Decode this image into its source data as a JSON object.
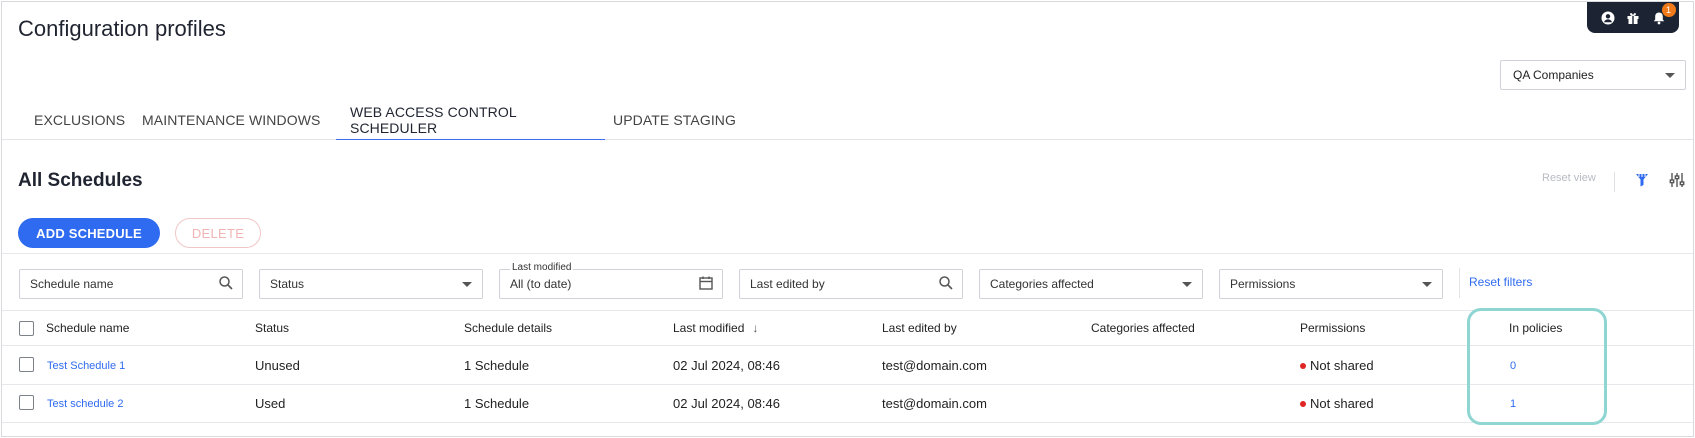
{
  "page": {
    "title": "Configuration profiles"
  },
  "topbar": {
    "icons": [
      "user-icon",
      "gift-icon",
      "bell-icon"
    ],
    "notification_count": "1"
  },
  "company_select": {
    "value": "QA Companies"
  },
  "tabs": [
    {
      "label": "EXCLUSIONS",
      "active": false
    },
    {
      "label": "MAINTENANCE WINDOWS",
      "active": false
    },
    {
      "label": "WEB ACCESS CONTROL SCHEDULER",
      "active": true
    },
    {
      "label": "UPDATE STAGING",
      "active": false
    }
  ],
  "section": {
    "title": "All Schedules",
    "reset_view": "Reset view"
  },
  "actions": {
    "add": "ADD SCHEDULE",
    "delete": "DELETE"
  },
  "filters": {
    "schedule_name": "Schedule name",
    "status": "Status",
    "last_modified_label": "Last modified",
    "last_modified_value": "All (to date)",
    "last_edited_by": "Last edited by",
    "categories": "Categories affected",
    "permissions": "Permissions",
    "reset": "Reset filters"
  },
  "table": {
    "columns": [
      "Schedule name",
      "Status",
      "Schedule details",
      "Last modified",
      "Last edited by",
      "Categories affected",
      "Permissions",
      "In policies"
    ],
    "rows": [
      {
        "name": "Test Schedule 1",
        "status": "Unused",
        "details": "1 Schedule",
        "modified": "02 Jul 2024, 08:46",
        "edited_by": "test@domain.com",
        "categories": "",
        "permissions": "Not shared",
        "policies": "0"
      },
      {
        "name": "Test schedule 2",
        "status": "Used",
        "details": "1 Schedule",
        "modified": "02 Jul 2024, 08:46",
        "edited_by": "test@domain.com",
        "categories": "",
        "permissions": "Not shared",
        "policies": "1"
      }
    ]
  },
  "colors": {
    "accent": "#2f6bf0",
    "highlight": "#8fd6d2",
    "not_shared_dot": "#e02525",
    "topbar": "#1c2433"
  }
}
